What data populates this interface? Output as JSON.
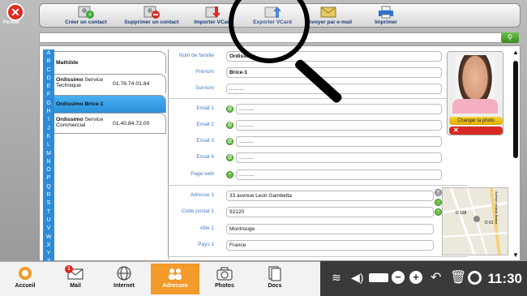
{
  "window": {
    "close_label": "Fermer"
  },
  "toolbar": {
    "buttons": [
      {
        "label": "Créer un contact",
        "icon": "add-contact-icon"
      },
      {
        "label": "Supprimer un contact",
        "icon": "remove-contact-icon"
      },
      {
        "label": "Importer VCard",
        "icon": "import-vcard-icon"
      },
      {
        "label": "Exporter VCard",
        "icon": "export-vcard-icon"
      },
      {
        "label": "Envoyer par e-mail",
        "icon": "send-email-icon"
      },
      {
        "label": "Imprimer",
        "icon": "printer-icon"
      }
    ]
  },
  "search": {
    "value": "",
    "button_icon": "search-go-icon"
  },
  "alphabet": [
    "A",
    "B",
    "C",
    "D",
    "E",
    "F",
    "G",
    "H",
    "I",
    "J",
    "K",
    "L",
    "M",
    "N",
    "O",
    "P",
    "Q",
    "R",
    "S",
    "T",
    "U",
    "V",
    "W",
    "X",
    "Y",
    "Z"
  ],
  "contacts": [
    {
      "name_bold": "Mathilde",
      "name_rest": "",
      "phone": "",
      "selected": false
    },
    {
      "name_bold": "Ordissimo",
      "name_rest": " Service Technique",
      "phone": "01.76.74.01.84",
      "selected": false
    },
    {
      "name_bold": "Ordissimo Brice-1",
      "name_rest": "",
      "phone": "",
      "selected": true
    },
    {
      "name_bold": "Ordissimo",
      "name_rest": " Service Commercial",
      "phone": "01.40.84.72.00",
      "selected": false
    }
  ],
  "form": {
    "nom_label": "Nom de famille",
    "nom_value": "Ordissimo",
    "prenom_label": "Prénom",
    "prenom_value": "Brice-1",
    "surnom_label": "Surnom",
    "surnom_value": "..........",
    "email1_label": "Email 1",
    "email1_value": "..........",
    "email2_label": "Email 2",
    "email2_value": "..........",
    "email3_label": "Email 3",
    "email3_value": "..........",
    "email4_label": "Email 4",
    "email4_value": "..........",
    "web_label": "Page web",
    "web_value": "..........",
    "adresse_label": "Adresse 1",
    "adresse_value": "33 avenue Leon Gambetta",
    "cp_label": "Code postal 1",
    "cp_value": "92120",
    "ville_label": "Ville 1",
    "ville_value": "Montrouge",
    "pays_label": "Pays 1",
    "pays_value": "France"
  },
  "photo": {
    "change_label": "Changer la photo",
    "delete_icon": "close-icon"
  },
  "map": {
    "label_d128": "D 128",
    "label_d61": "D 61",
    "label_av": "Avenue Aristide Briand"
  },
  "taskbar": {
    "apps": [
      {
        "label": "Accueil",
        "icon": "home-icon",
        "active": false
      },
      {
        "label": "Mail",
        "icon": "mail-icon",
        "active": false,
        "badge": "1"
      },
      {
        "label": "Internet",
        "icon": "globe-icon",
        "active": false
      },
      {
        "label": "Adresses",
        "icon": "contacts-icon",
        "active": true
      },
      {
        "label": "Photos",
        "icon": "camera-icon",
        "active": false
      },
      {
        "label": "Docs",
        "icon": "docs-icon",
        "active": false
      }
    ],
    "time": "11:30"
  }
}
